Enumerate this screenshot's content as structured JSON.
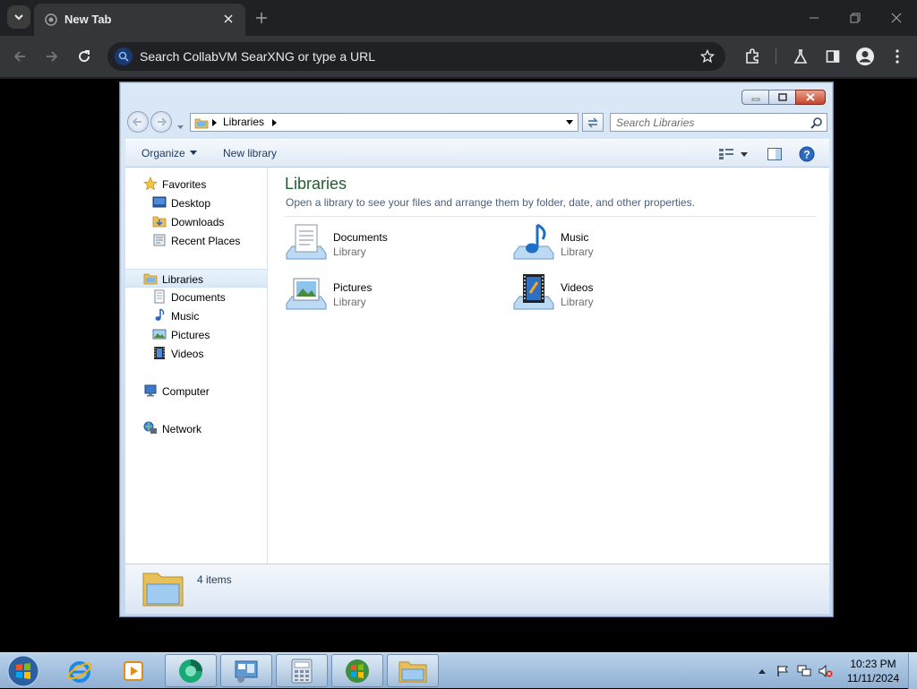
{
  "browser": {
    "tab_title": "New Tab",
    "omnibox_placeholder": "Search CollabVM SearXNG or type a URL"
  },
  "explorer": {
    "breadcrumb": "Libraries",
    "search_placeholder": "Search Libraries",
    "toolbar": {
      "organize": "Organize",
      "new_library": "New library"
    },
    "nav": {
      "favorites": "Favorites",
      "desktop": "Desktop",
      "downloads": "Downloads",
      "recent_places": "Recent Places",
      "libraries": "Libraries",
      "documents": "Documents",
      "music": "Music",
      "pictures": "Pictures",
      "videos": "Videos",
      "computer": "Computer",
      "network": "Network"
    },
    "content": {
      "title": "Libraries",
      "subtitle": "Open a library to see your files and arrange them by folder, date, and other properties.",
      "items": [
        {
          "name": "Documents",
          "type": "Library"
        },
        {
          "name": "Music",
          "type": "Library"
        },
        {
          "name": "Pictures",
          "type": "Library"
        },
        {
          "name": "Videos",
          "type": "Library"
        }
      ]
    },
    "status": {
      "count": "4 items"
    }
  },
  "taskbar": {
    "time": "10:23 PM",
    "date": "11/11/2024"
  },
  "colors": {
    "chrome_bg": "#202124",
    "chrome_toolbar": "#35363a",
    "explorer_title_green": "#1e5e2e",
    "taskbar": "#9fbcdc"
  }
}
